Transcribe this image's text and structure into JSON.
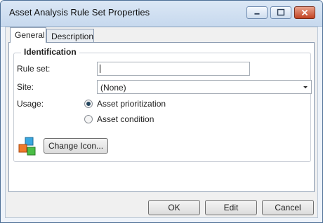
{
  "window": {
    "title": "Asset Analysis Rule Set Properties"
  },
  "tabs": [
    {
      "label": "General",
      "active": true
    },
    {
      "label": "Description",
      "active": false
    }
  ],
  "identification": {
    "title": "Identification",
    "rule_set_label": "Rule set:",
    "rule_set_value": "",
    "site_label": "Site:",
    "site_value": "(None)",
    "usage_label": "Usage:",
    "usage_options": [
      {
        "label": "Asset prioritization",
        "checked": true
      },
      {
        "label": "Asset condition",
        "checked": false
      }
    ],
    "icon_name": "colored-cubes-icon",
    "change_icon_label": "Change Icon..."
  },
  "footer": {
    "ok_label": "OK",
    "edit_label": "Edit",
    "cancel_label": "Cancel"
  },
  "colors": {
    "title_bar": "#c7d9ee",
    "close_button": "#c24424",
    "border": "#4d6f96"
  }
}
